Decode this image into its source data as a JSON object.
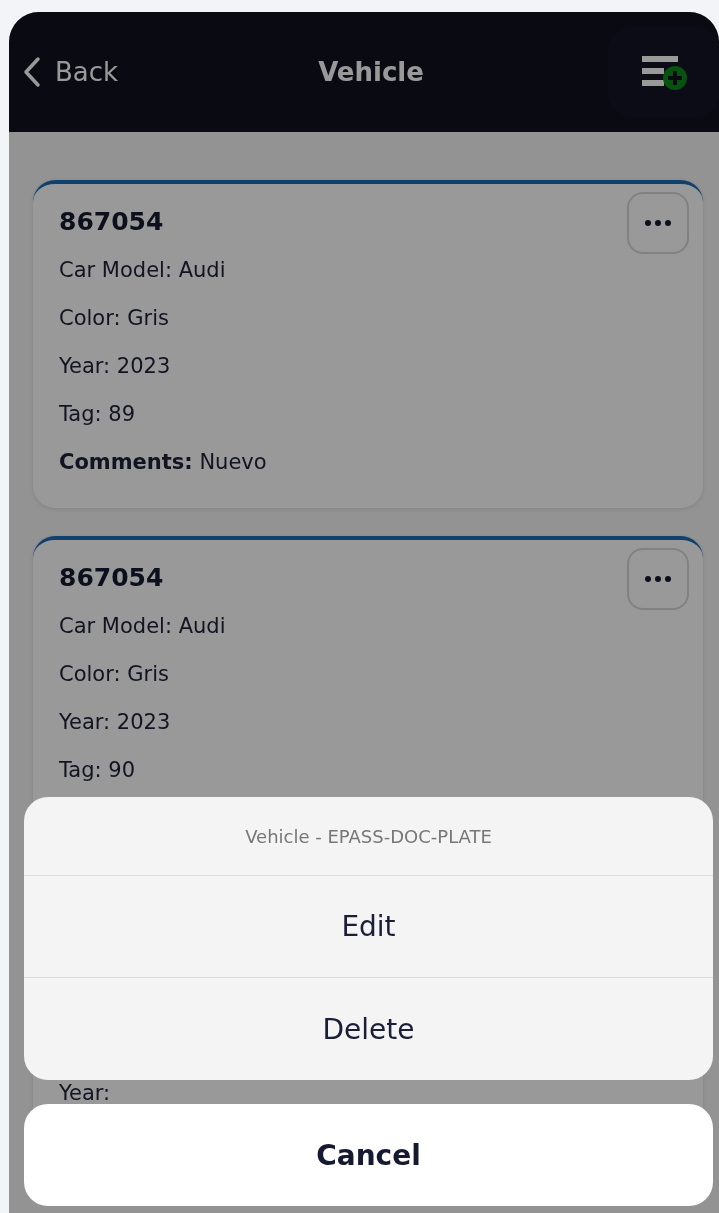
{
  "header": {
    "back_label": "Back",
    "title": "Vehicle"
  },
  "vehicles": [
    {
      "number": "867054",
      "fields": [
        {
          "label": "Car Model:",
          "value": "Audi",
          "kind": "plain"
        },
        {
          "label": "Color:",
          "value": "Gris",
          "kind": "plain"
        },
        {
          "label": "Year:",
          "value": "2023",
          "kind": "plain"
        },
        {
          "label": "Tag:",
          "value": "89",
          "kind": "plain"
        },
        {
          "label": "Comments:",
          "value": "Nuevo",
          "kind": "bold"
        }
      ]
    },
    {
      "number": "867054",
      "fields": [
        {
          "label": "Car Model:",
          "value": "Audi",
          "kind": "plain"
        },
        {
          "label": "Color:",
          "value": "Gris",
          "kind": "plain"
        },
        {
          "label": "Year:",
          "value": "2023",
          "kind": "plain"
        },
        {
          "label": "Tag:",
          "value": "90",
          "kind": "plain"
        }
      ]
    },
    {
      "fields": [
        {
          "label": "Year:",
          "kind": "plain"
        }
      ]
    }
  ],
  "action_sheet": {
    "title": "Vehicle - EPASS-DOC-PLATE",
    "actions": [
      "Edit",
      "Delete"
    ],
    "cancel": "Cancel"
  }
}
